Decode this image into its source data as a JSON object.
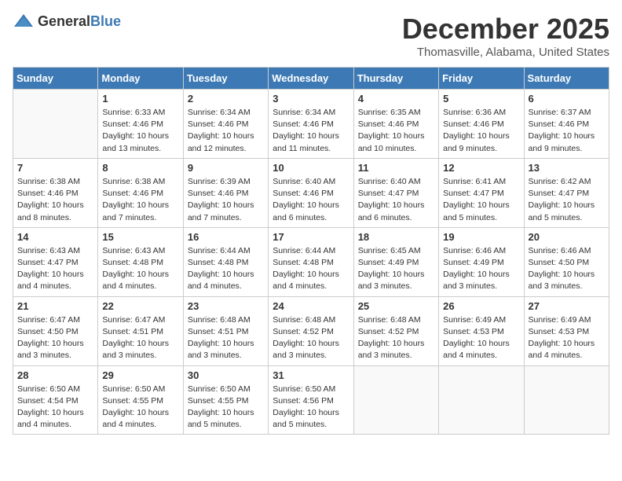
{
  "header": {
    "logo_general": "General",
    "logo_blue": "Blue",
    "month": "December 2025",
    "location": "Thomasville, Alabama, United States"
  },
  "days_of_week": [
    "Sunday",
    "Monday",
    "Tuesday",
    "Wednesday",
    "Thursday",
    "Friday",
    "Saturday"
  ],
  "weeks": [
    [
      {
        "day": "",
        "info": ""
      },
      {
        "day": "1",
        "info": "Sunrise: 6:33 AM\nSunset: 4:46 PM\nDaylight: 10 hours\nand 13 minutes."
      },
      {
        "day": "2",
        "info": "Sunrise: 6:34 AM\nSunset: 4:46 PM\nDaylight: 10 hours\nand 12 minutes."
      },
      {
        "day": "3",
        "info": "Sunrise: 6:34 AM\nSunset: 4:46 PM\nDaylight: 10 hours\nand 11 minutes."
      },
      {
        "day": "4",
        "info": "Sunrise: 6:35 AM\nSunset: 4:46 PM\nDaylight: 10 hours\nand 10 minutes."
      },
      {
        "day": "5",
        "info": "Sunrise: 6:36 AM\nSunset: 4:46 PM\nDaylight: 10 hours\nand 9 minutes."
      },
      {
        "day": "6",
        "info": "Sunrise: 6:37 AM\nSunset: 4:46 PM\nDaylight: 10 hours\nand 9 minutes."
      }
    ],
    [
      {
        "day": "7",
        "info": "Sunrise: 6:38 AM\nSunset: 4:46 PM\nDaylight: 10 hours\nand 8 minutes."
      },
      {
        "day": "8",
        "info": "Sunrise: 6:38 AM\nSunset: 4:46 PM\nDaylight: 10 hours\nand 7 minutes."
      },
      {
        "day": "9",
        "info": "Sunrise: 6:39 AM\nSunset: 4:46 PM\nDaylight: 10 hours\nand 7 minutes."
      },
      {
        "day": "10",
        "info": "Sunrise: 6:40 AM\nSunset: 4:46 PM\nDaylight: 10 hours\nand 6 minutes."
      },
      {
        "day": "11",
        "info": "Sunrise: 6:40 AM\nSunset: 4:47 PM\nDaylight: 10 hours\nand 6 minutes."
      },
      {
        "day": "12",
        "info": "Sunrise: 6:41 AM\nSunset: 4:47 PM\nDaylight: 10 hours\nand 5 minutes."
      },
      {
        "day": "13",
        "info": "Sunrise: 6:42 AM\nSunset: 4:47 PM\nDaylight: 10 hours\nand 5 minutes."
      }
    ],
    [
      {
        "day": "14",
        "info": "Sunrise: 6:43 AM\nSunset: 4:47 PM\nDaylight: 10 hours\nand 4 minutes."
      },
      {
        "day": "15",
        "info": "Sunrise: 6:43 AM\nSunset: 4:48 PM\nDaylight: 10 hours\nand 4 minutes."
      },
      {
        "day": "16",
        "info": "Sunrise: 6:44 AM\nSunset: 4:48 PM\nDaylight: 10 hours\nand 4 minutes."
      },
      {
        "day": "17",
        "info": "Sunrise: 6:44 AM\nSunset: 4:48 PM\nDaylight: 10 hours\nand 4 minutes."
      },
      {
        "day": "18",
        "info": "Sunrise: 6:45 AM\nSunset: 4:49 PM\nDaylight: 10 hours\nand 3 minutes."
      },
      {
        "day": "19",
        "info": "Sunrise: 6:46 AM\nSunset: 4:49 PM\nDaylight: 10 hours\nand 3 minutes."
      },
      {
        "day": "20",
        "info": "Sunrise: 6:46 AM\nSunset: 4:50 PM\nDaylight: 10 hours\nand 3 minutes."
      }
    ],
    [
      {
        "day": "21",
        "info": "Sunrise: 6:47 AM\nSunset: 4:50 PM\nDaylight: 10 hours\nand 3 minutes."
      },
      {
        "day": "22",
        "info": "Sunrise: 6:47 AM\nSunset: 4:51 PM\nDaylight: 10 hours\nand 3 minutes."
      },
      {
        "day": "23",
        "info": "Sunrise: 6:48 AM\nSunset: 4:51 PM\nDaylight: 10 hours\nand 3 minutes."
      },
      {
        "day": "24",
        "info": "Sunrise: 6:48 AM\nSunset: 4:52 PM\nDaylight: 10 hours\nand 3 minutes."
      },
      {
        "day": "25",
        "info": "Sunrise: 6:48 AM\nSunset: 4:52 PM\nDaylight: 10 hours\nand 3 minutes."
      },
      {
        "day": "26",
        "info": "Sunrise: 6:49 AM\nSunset: 4:53 PM\nDaylight: 10 hours\nand 4 minutes."
      },
      {
        "day": "27",
        "info": "Sunrise: 6:49 AM\nSunset: 4:53 PM\nDaylight: 10 hours\nand 4 minutes."
      }
    ],
    [
      {
        "day": "28",
        "info": "Sunrise: 6:50 AM\nSunset: 4:54 PM\nDaylight: 10 hours\nand 4 minutes."
      },
      {
        "day": "29",
        "info": "Sunrise: 6:50 AM\nSunset: 4:55 PM\nDaylight: 10 hours\nand 4 minutes."
      },
      {
        "day": "30",
        "info": "Sunrise: 6:50 AM\nSunset: 4:55 PM\nDaylight: 10 hours\nand 5 minutes."
      },
      {
        "day": "31",
        "info": "Sunrise: 6:50 AM\nSunset: 4:56 PM\nDaylight: 10 hours\nand 5 minutes."
      },
      {
        "day": "",
        "info": ""
      },
      {
        "day": "",
        "info": ""
      },
      {
        "day": "",
        "info": ""
      }
    ]
  ]
}
